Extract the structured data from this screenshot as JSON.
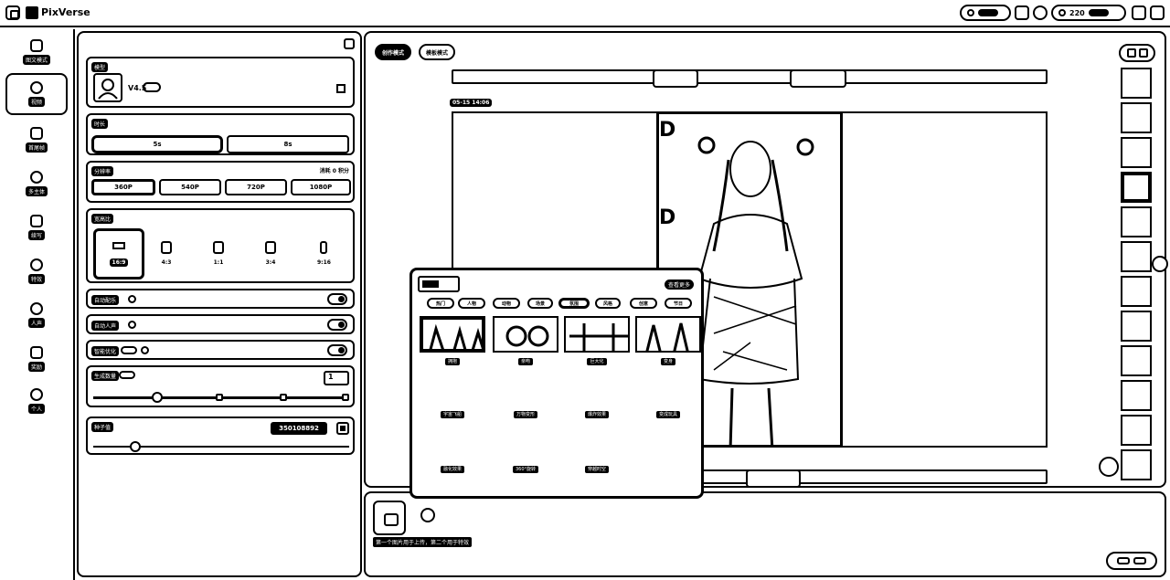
{
  "app": {
    "name": "PixVerse"
  },
  "topbar": {
    "credits_label": "220"
  },
  "rail": {
    "items": [
      {
        "label": "图文模式"
      },
      {
        "label": "视频"
      },
      {
        "label": "首尾帧"
      },
      {
        "label": "多主体"
      },
      {
        "label": "续写"
      },
      {
        "label": "特效"
      },
      {
        "label": "人声"
      },
      {
        "label": "奖励"
      },
      {
        "label": "个人"
      }
    ]
  },
  "settings": {
    "model": {
      "title": "模型",
      "version": "V4.5"
    },
    "duration": {
      "title": "时长",
      "options": [
        "5s",
        "8s"
      ]
    },
    "resolution": {
      "title": "分辨率",
      "hint": "消耗 0 积分",
      "options": [
        "360P",
        "540P",
        "720P",
        "1080P"
      ]
    },
    "ratio": {
      "title": "宽高比",
      "options": [
        "16:9",
        "4:3",
        "1:1",
        "3:4",
        "9:16"
      ]
    },
    "toggles": [
      {
        "label": "自动配乐"
      },
      {
        "label": "自动人声"
      },
      {
        "label": "智能优化"
      }
    ],
    "count": {
      "title": "生成数量",
      "value": "1"
    },
    "seed": {
      "title": "种子值",
      "value": "350108892"
    }
  },
  "main": {
    "tabs": [
      "创作模式",
      "模板模式"
    ],
    "timestamp": "05-15 14:06"
  },
  "bottom": {
    "hint": "第一个图片用于上传，第二个用于特效"
  },
  "popover": {
    "more_label": "查看更多",
    "categories": [
      "热门",
      "人物",
      "动物",
      "场景",
      "氛围",
      "风格",
      "创意",
      "节日"
    ],
    "effects_row1": [
      "拥抱",
      "亲吻",
      "巨大化",
      "变身"
    ],
    "effects_row2": [
      "宇宙飞船",
      "万物变形",
      "爆炸效果",
      "变成玩具"
    ],
    "effects_row3": [
      "融化效果",
      "360°旋转",
      "穿越时空"
    ]
  }
}
